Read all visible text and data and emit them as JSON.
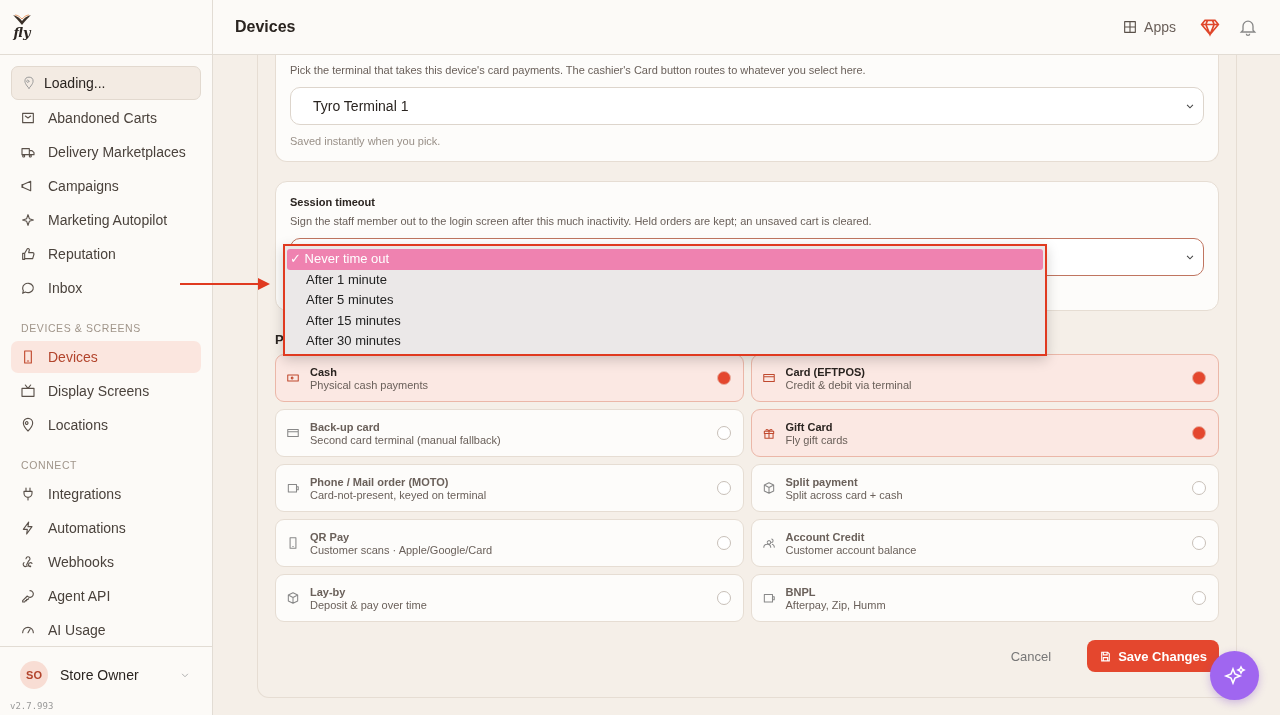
{
  "logo": {
    "text": "fly"
  },
  "sidebar": {
    "location": "Loading...",
    "sections": [
      {
        "items": [
          {
            "label": "Abandoned Carts",
            "selected": false
          },
          {
            "label": "Delivery Marketplaces",
            "selected": false
          },
          {
            "label": "Campaigns",
            "selected": false
          },
          {
            "label": "Marketing Autopilot",
            "selected": false
          },
          {
            "label": "Reputation",
            "selected": false
          },
          {
            "label": "Inbox",
            "selected": false
          }
        ]
      },
      {
        "label": "DEVICES & SCREENS",
        "items": [
          {
            "label": "Devices",
            "selected": true
          },
          {
            "label": "Display Screens",
            "selected": false
          },
          {
            "label": "Locations",
            "selected": false
          }
        ]
      },
      {
        "label": "CONNECT",
        "items": [
          {
            "label": "Integrations",
            "selected": false
          },
          {
            "label": "Automations",
            "selected": false
          },
          {
            "label": "Webhooks",
            "selected": false
          },
          {
            "label": "Agent API",
            "selected": false
          },
          {
            "label": "AI Usage",
            "selected": false
          }
        ]
      }
    ],
    "user": {
      "initials": "SO",
      "name": "Store Owner"
    },
    "version": "v2.7.993"
  },
  "header": {
    "title": "Devices",
    "apps": "Apps"
  },
  "terminal_card": {
    "description": "Pick the terminal that takes this device's card payments. The cashier's Card button routes to whatever you select here.",
    "select": {
      "value": "Tyro Terminal 1"
    },
    "hint": "Saved instantly when you pick."
  },
  "session_card": {
    "title": "Session timeout",
    "description": "Sign the staff member out to the login screen after this much inactivity. Held orders are kept; an unsaved cart is cleared.",
    "dropdown": {
      "check_mark": "✓",
      "options": [
        {
          "label": "Never time out",
          "selected": true
        },
        {
          "label": "After 1 minute",
          "selected": false
        },
        {
          "label": "After 5 minutes",
          "selected": false
        },
        {
          "label": "After 15 minutes",
          "selected": false
        },
        {
          "label": "After 30 minutes",
          "selected": false
        }
      ]
    }
  },
  "payments": {
    "heading": "P",
    "methods": [
      {
        "name": "Cash",
        "detail": "Physical cash payments",
        "selected": true
      },
      {
        "name": "Card (EFTPOS)",
        "detail": "Credit & debit via terminal",
        "selected": true
      },
      {
        "name": "Back-up card",
        "detail": "Second card terminal (manual fallback)",
        "selected": false
      },
      {
        "name": "Gift Card",
        "detail": "Fly gift cards",
        "selected": true
      },
      {
        "name": "Phone / Mail order (MOTO)",
        "detail": "Card-not-present, keyed on terminal",
        "selected": false
      },
      {
        "name": "Split payment",
        "detail": "Split across card + cash",
        "selected": false
      },
      {
        "name": "QR Pay",
        "detail": "Customer scans · Apple/Google/Card",
        "selected": false
      },
      {
        "name": "Account Credit",
        "detail": "Customer account balance",
        "selected": false
      },
      {
        "name": "Lay-by",
        "detail": "Deposit & pay over time",
        "selected": false
      },
      {
        "name": "BNPL",
        "detail": "Afterpay, Zip, Humm",
        "selected": false
      }
    ]
  },
  "footer": {
    "cancel": "Cancel",
    "save": "Save Changes"
  }
}
